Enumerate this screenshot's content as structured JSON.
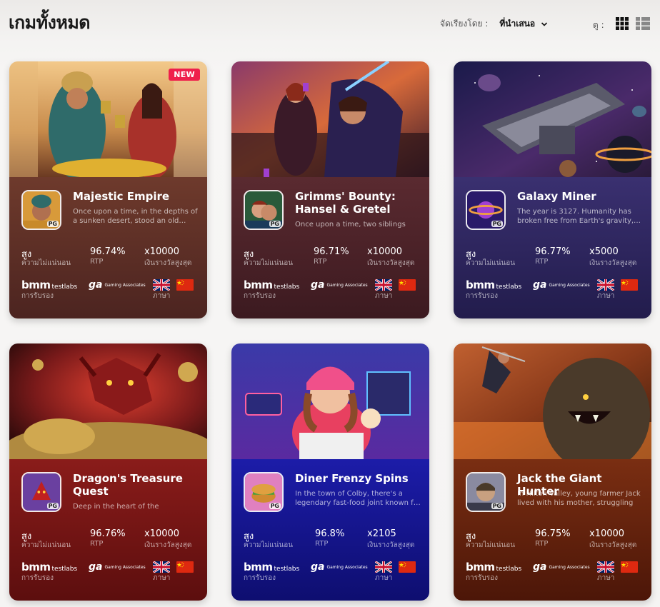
{
  "header": {
    "title": "เกมทั้งหมด",
    "sort_label": "จัดเรียงโดย :",
    "sort_value": "ที่นำเสนอ",
    "view_label": "ดู :"
  },
  "labels": {
    "volatility": "ความไม่แน่นอน",
    "rtp": "RTP",
    "max_win": "เงินรางวัลสูงสุด",
    "certification": "การรับรอง",
    "language": "ภาษา",
    "bmm_main": "bmm",
    "bmm_sub": "testlabs",
    "ga_mark": "ga",
    "ga_text": "Gaming Associates",
    "pg_tag": "PG"
  },
  "colors": {
    "new_badge": "#ef1f4c",
    "card_brown": "#5a2a24",
    "card_navy": "#2a2560",
    "card_red": "#8a1a18",
    "card_blue": "#1a1aa0",
    "card_orange": "#7a2a10"
  },
  "games": [
    {
      "name": "Majestic Empire",
      "description": "Once upon a time, in the depths of a sunken desert, stood an old…",
      "badge": "NEW",
      "volatility": "สูง",
      "rtp": "96.74%",
      "max_win": "x10000"
    },
    {
      "name": "Grimms' Bounty: Hansel & Gretel",
      "description": "Once upon a time, two siblings",
      "badge": "",
      "volatility": "สูง",
      "rtp": "96.71%",
      "max_win": "x10000"
    },
    {
      "name": "Galaxy Miner",
      "description": "The year is 3127. Humanity has broken free from Earth's gravity,…",
      "badge": "",
      "volatility": "สูง",
      "rtp": "96.77%",
      "max_win": "x5000"
    },
    {
      "name": "Dragon's Treasure Quest",
      "description": "Deep in the heart of the mysterious",
      "badge": "",
      "volatility": "สูง",
      "rtp": "96.76%",
      "max_win": "x10000"
    },
    {
      "name": "Diner Frenzy Spins",
      "description": "In the town of Colby, there's a legendary fast-food joint known f…",
      "badge": "",
      "volatility": "สูง",
      "rtp": "96.8%",
      "max_win": "x2105"
    },
    {
      "name": "Jack the Giant Hunter",
      "description": "In Hilton Valley, young farmer Jack lived with his mother, struggling to…",
      "badge": "",
      "volatility": "สูง",
      "rtp": "96.75%",
      "max_win": "x10000"
    }
  ]
}
